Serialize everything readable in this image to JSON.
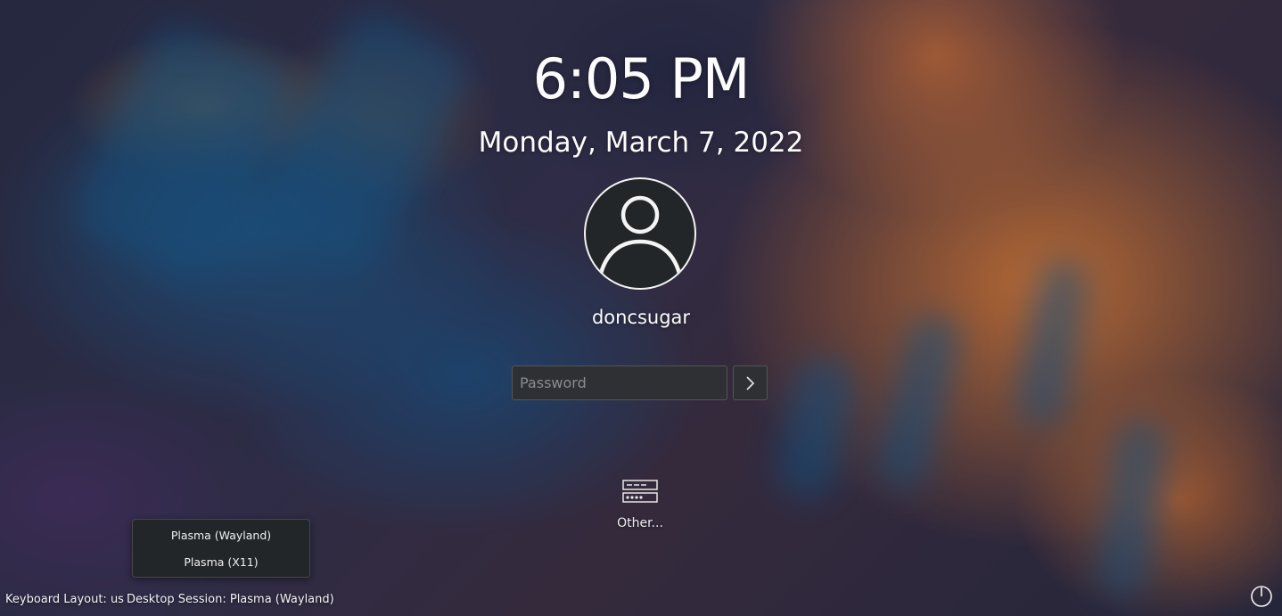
{
  "clock": {
    "time": "6:05 PM",
    "date": "Monday, March 7, 2022"
  },
  "user": {
    "name": "doncsugar",
    "avatar_icon": "user-avatar-icon"
  },
  "login": {
    "password_placeholder": "Password",
    "password_value": "",
    "submit_icon": "chevron-right-icon"
  },
  "actions": {
    "other_label": "Other...",
    "other_icon": "server-icon"
  },
  "session_menu": {
    "items": [
      {
        "label": "Plasma (Wayland)"
      },
      {
        "label": "Plasma (X11)"
      }
    ]
  },
  "footer": {
    "keyboard_layout": "Keyboard Layout: us",
    "desktop_session": "Desktop Session: Plasma (Wayland)",
    "power_icon": "power-icon"
  },
  "colors": {
    "foreground": "#fcfcfc",
    "field_background": "#2f3034",
    "menu_background": "#232629",
    "wallpaper_orange": "#d67a3a",
    "wallpaper_blue": "#1e5a8c"
  }
}
